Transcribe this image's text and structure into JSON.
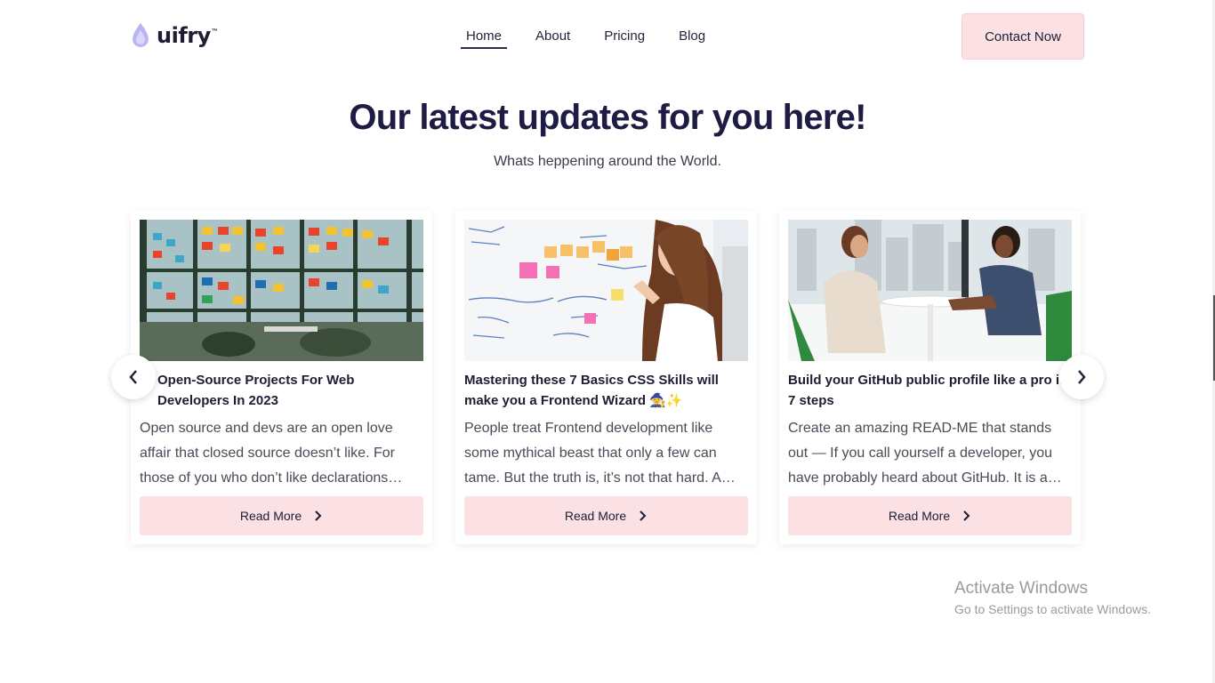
{
  "header": {
    "logo_text": "uifry",
    "logo_tm": "™",
    "nav": [
      {
        "label": "Home",
        "active": true
      },
      {
        "label": "About",
        "active": false
      },
      {
        "label": "Pricing",
        "active": false
      },
      {
        "label": "Blog",
        "active": false
      }
    ],
    "contact_label": "Contact Now"
  },
  "hero": {
    "title": "Our latest updates for you here!",
    "subtitle": "Whats heppening around the World."
  },
  "cards": [
    {
      "title": "Open-Source Projects For Web Developers In 2023",
      "description": "Open source and devs are an open love affair that closed source doesn’t like. For those of you who don’t like declarations…",
      "button_label": "Read More",
      "image": "office-sticky-notes-glass-wall"
    },
    {
      "title": "Mastering these 7 Basics CSS Skills will make you a Frontend Wizard 🧙✨",
      "description": "People treat Frontend development like some mythical beast that only a few can tame. But the truth is, it’s not that hard. A…",
      "button_label": "Read More",
      "image": "woman-whiteboard-sticky-notes"
    },
    {
      "title": "Build your GitHub public profile like a pro in 7 steps",
      "description": "Create an amazing READ-ME that stands out — If you call yourself a developer, you have probably heard about GitHub. It is a…",
      "button_label": "Read More",
      "image": "two-women-meeting-table"
    }
  ],
  "carousel": {
    "prev_icon": "chevron-left-icon",
    "next_icon": "chevron-right-icon"
  },
  "watermark": {
    "line1": "Activate Windows",
    "line2": "Go to Settings to activate Windows."
  },
  "colors": {
    "accent": "#fbe1e3",
    "title": "#1f1c44",
    "logo_drop": "#b9b6f2"
  }
}
